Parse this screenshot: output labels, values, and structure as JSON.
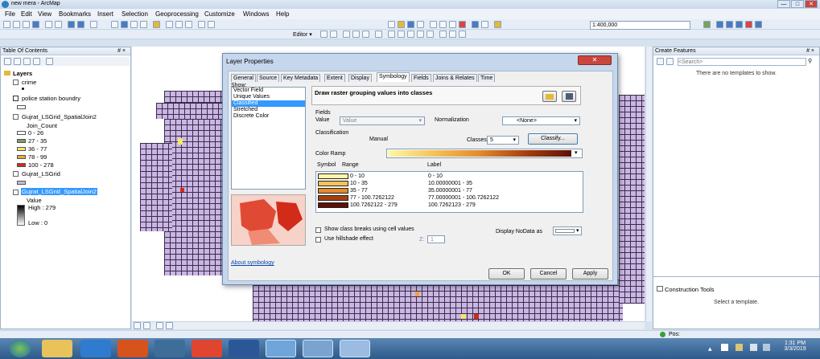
{
  "window": {
    "title": "new mera - ArcMap",
    "controls": [
      "—",
      "□",
      "✕"
    ]
  },
  "menu": [
    "File",
    "Edit",
    "View",
    "Bookmarks",
    "Insert",
    "Selection",
    "Geoprocessing",
    "Customize",
    "Windows",
    "Help"
  ],
  "toolbar": {
    "scale": "1:400,000",
    "editor_label": "Editor ▾"
  },
  "toc": {
    "title": "Table Of Contents",
    "pin": "# ×",
    "layers_label": "Layers",
    "items": {
      "crime": "crime",
      "police": "police station boundry",
      "join2": "Gujrat_LSGrid_SpatialJoin2",
      "join_count": "Join_Count",
      "class1": "0 - 26",
      "class2": "27 - 35",
      "class3": "36 - 77",
      "class4": "78 - 99",
      "class5": "100 - 278",
      "lsgrid": "Gujrat_LSGrid",
      "raster": "Gujrat_LSGrid_SpatialJoin2",
      "value": "Value",
      "high": "High : 279",
      "low": "Low : 0"
    },
    "class_colors": [
      "#ffffff",
      "#7ba05b",
      "#f5e66a",
      "#f0a33c",
      "#d22b1a"
    ]
  },
  "create_features": {
    "title": "Create Features",
    "pin": "# ×",
    "search_placeholder": "<Search>",
    "empty_msg": "There are no templates to show.",
    "construction_tools": "Construction Tools",
    "select_template": "Select a template."
  },
  "status": {
    "pos": "Pos:"
  },
  "dialog": {
    "title": "Layer Properties",
    "close": "✕",
    "tabs": [
      "General",
      "Source",
      "Key Metadata",
      "Extent",
      "Display",
      "Symbology",
      "Fields",
      "Joins & Relates",
      "Time"
    ],
    "active_tab": "Symbology",
    "show_label": "Show:",
    "show_items": [
      "Vector Field",
      "Unique Values",
      "Classified",
      "Stretched",
      "Discrete Color"
    ],
    "show_selected": "Classified",
    "heading": "Draw raster grouping values into classes",
    "fields_label": "Fields",
    "value_label": "Value",
    "value_field": "Value",
    "normalization_label": "Normalization",
    "normalization_value": "<None>",
    "classification_label": "Classification",
    "method": "Manual",
    "classes_label": "Classes",
    "classes_value": "5",
    "classify_button": "Classify...",
    "color_ramp_label": "Color Ramp",
    "table_headers": {
      "symbol": "Symbol",
      "range": "Range",
      "label": "Label"
    },
    "classes": [
      {
        "color": "#fff7a8",
        "range": "0 - 10",
        "label": "0 - 10"
      },
      {
        "color": "#f5c25a",
        "range": "10 - 35",
        "label": "10.00000001 - 35"
      },
      {
        "color": "#e48a2a",
        "range": "35 - 77",
        "label": "35.00000001 - 77"
      },
      {
        "color": "#a6400f",
        "range": "77 - 100.7262122",
        "label": "77.00000001 - 100.7262122"
      },
      {
        "color": "#5e1005",
        "range": "100.7262122 - 279",
        "label": "100.7262123 - 279"
      }
    ],
    "show_breaks": "Show class breaks using cell values",
    "hillshade": "Use hillshade effect",
    "z_label": "Z:",
    "z_value": "1",
    "nodata_label": "Display NoData as",
    "about": "About symbology",
    "ok": "OK",
    "cancel": "Cancel",
    "apply": "Apply"
  },
  "taskbar": {
    "time": "1:31 PM",
    "date": "3/3/2019"
  }
}
